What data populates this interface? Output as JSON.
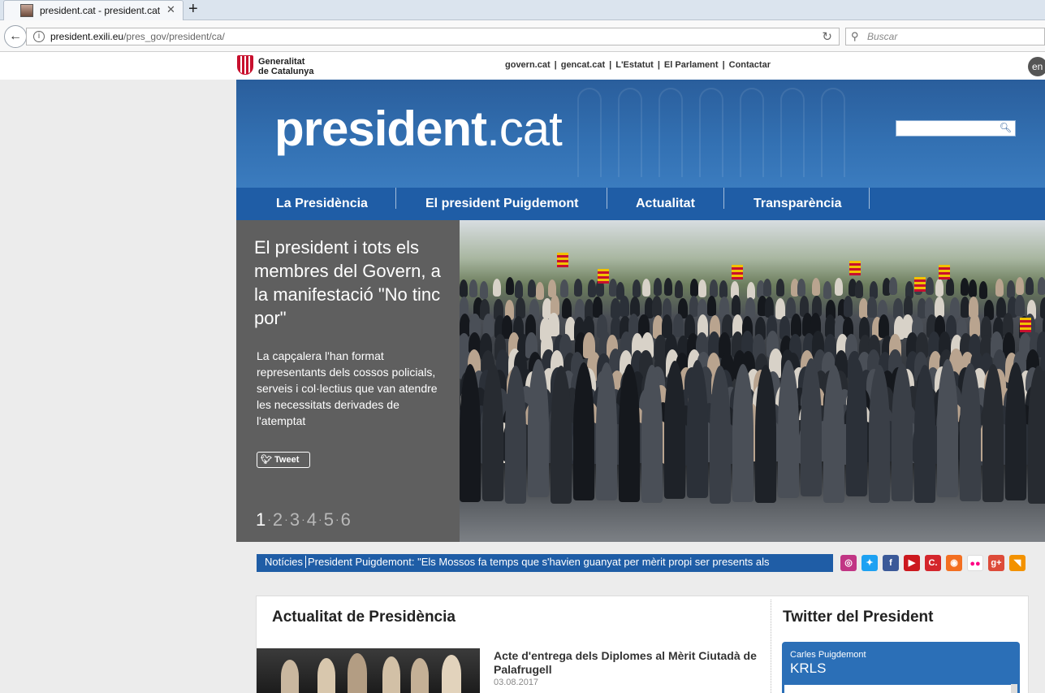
{
  "browser": {
    "tab_title": "president.cat - president.cat",
    "tab_close": "✕",
    "new_tab": "+",
    "url_host": "president.exili.eu",
    "url_path": "/pres_gov/president/ca/",
    "search_placeholder": "Buscar"
  },
  "header": {
    "logo_line1": "Generalitat",
    "logo_line2": "de Catalunya",
    "links": [
      "govern.cat",
      "gencat.cat",
      "L'Estatut",
      "El Parlament",
      "Contactar"
    ],
    "lang": "en"
  },
  "banner": {
    "title_bold": "president",
    "title_suffix": ".cat"
  },
  "nav": [
    "La Presidència",
    "El president Puigdemont",
    "Actualitat",
    "Transparència"
  ],
  "slider": {
    "title": "El president i tots els membres del Govern, a la manifestació \"No tinc por\"",
    "description": "La capçalera l'han format representants dels cossos policials, serveis i col·lectius que van atendre les necessitats derivades de l'atemptat",
    "tweet_label": "Tweet",
    "pages": [
      "1",
      "2",
      "3",
      "4",
      "5",
      "6"
    ],
    "active_page": "1"
  },
  "ticker": {
    "label": "Notícies",
    "text": "President Puigdemont: \"Els Mossos fa temps que s'havien guanyat per mèrit propi ser presents als"
  },
  "social_icons": [
    {
      "name": "instagram-icon",
      "glyph": "◎",
      "color": "#c13584"
    },
    {
      "name": "twitter-icon",
      "glyph": "✦",
      "color": "#1da1f2"
    },
    {
      "name": "facebook-icon",
      "glyph": "f",
      "color": "#3b5998"
    },
    {
      "name": "youtube-icon",
      "glyph": "▶",
      "color": "#cc181e"
    },
    {
      "name": "c-icon",
      "glyph": "C.",
      "color": "#d4262c"
    },
    {
      "name": "ivoox-icon",
      "glyph": "◉",
      "color": "#f36f21"
    },
    {
      "name": "flickr-icon",
      "glyph": "●●",
      "color": "#ffffff"
    },
    {
      "name": "googleplus-icon",
      "glyph": "g+",
      "color": "#dd4b39"
    },
    {
      "name": "rss-icon",
      "glyph": "◥",
      "color": "#f39200"
    }
  ],
  "actualitat": {
    "heading": "Actualitat de Presidència",
    "news_title": "Acte d'entrega dels Diplomes al Mèrit Ciutadà de Palafrugell",
    "news_date": "03.08.2017"
  },
  "twitter": {
    "heading": "Twitter del President",
    "name": "Carles Puigdemont",
    "handle": "KRLS"
  },
  "colors": {
    "brand_blue": "#1f5da6",
    "panel_gray": "#5f5f5f"
  }
}
